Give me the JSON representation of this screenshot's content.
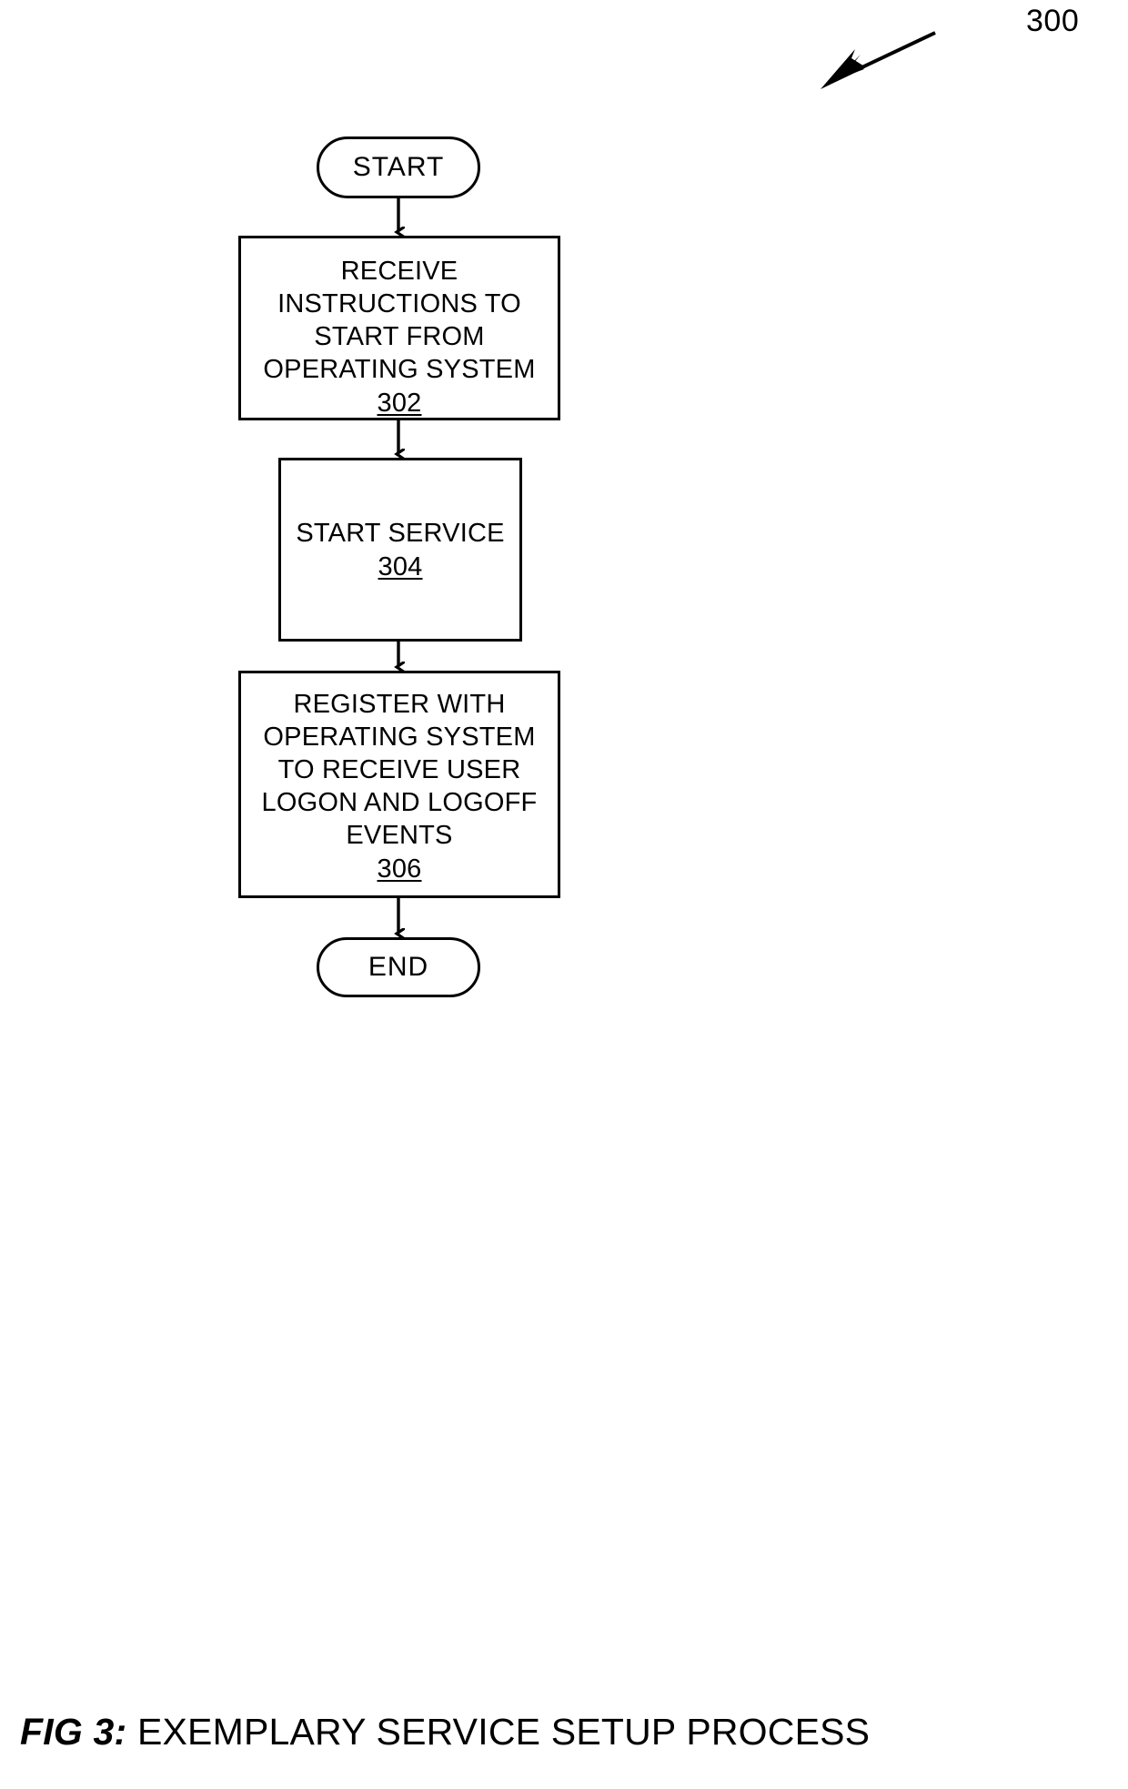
{
  "figure": {
    "reference_numeral": "300",
    "caption_label": "FIG 3:",
    "caption_text": "EXEMPLARY SERVICE SETUP PROCESS",
    "line_color": "#000000",
    "background_color": "#ffffff"
  },
  "nodes": {
    "start": {
      "label": "START",
      "shape": "terminator"
    },
    "step_302": {
      "label": "RECEIVE\nINSTRUCTIONS TO\nSTART FROM\nOPERATING SYSTEM",
      "number": "302",
      "shape": "process"
    },
    "step_304": {
      "label": "START SERVICE",
      "number": "304",
      "shape": "process"
    },
    "step_306": {
      "label": "REGISTER WITH\nOPERATING SYSTEM\nTO RECEIVE USER\nLOGON AND LOGOFF\nEVENTS",
      "number": "306",
      "shape": "process"
    },
    "end": {
      "label": "END",
      "shape": "terminator"
    }
  },
  "connectors": [
    {
      "from": "start",
      "to": "step_302"
    },
    {
      "from": "step_302",
      "to": "step_304"
    },
    {
      "from": "step_304",
      "to": "step_306"
    },
    {
      "from": "step_306",
      "to": "end"
    }
  ]
}
